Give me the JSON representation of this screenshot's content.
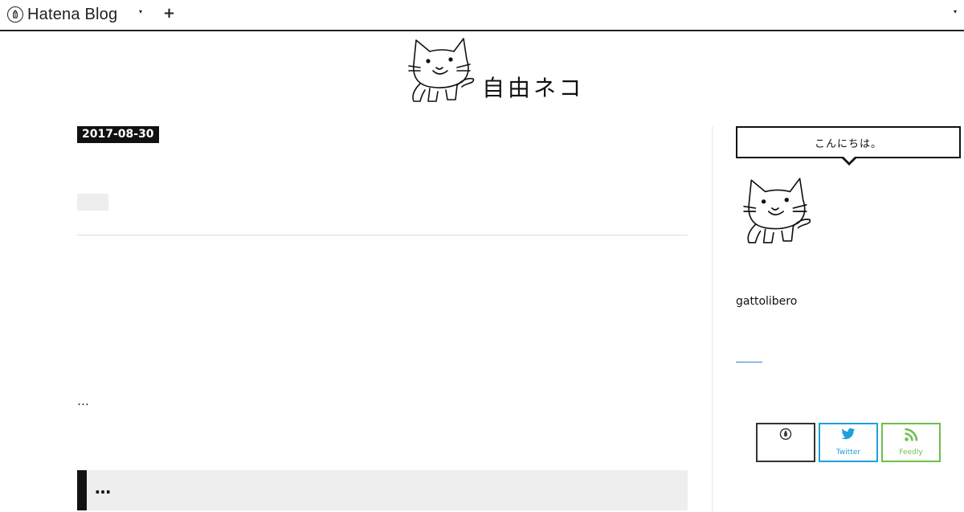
{
  "topbar": {
    "brand_name": "Hatena Blog",
    "menu_caret": "▾",
    "add_symbol": "+",
    "right_caret": "▾"
  },
  "header": {
    "title": "自由ネコ"
  },
  "entry": {
    "date": "2017-08-30",
    "excerpt": "…",
    "section_heading": "…"
  },
  "sidebar": {
    "greeting": "こんにちは。",
    "username": "gattolibero"
  },
  "subscribe": {
    "twitter_label": "Twitter",
    "feedly_label": "Feedly"
  },
  "colors": {
    "twitter": "#1da1d8",
    "feedly": "#6cc04a",
    "accent_dark": "#111111"
  }
}
